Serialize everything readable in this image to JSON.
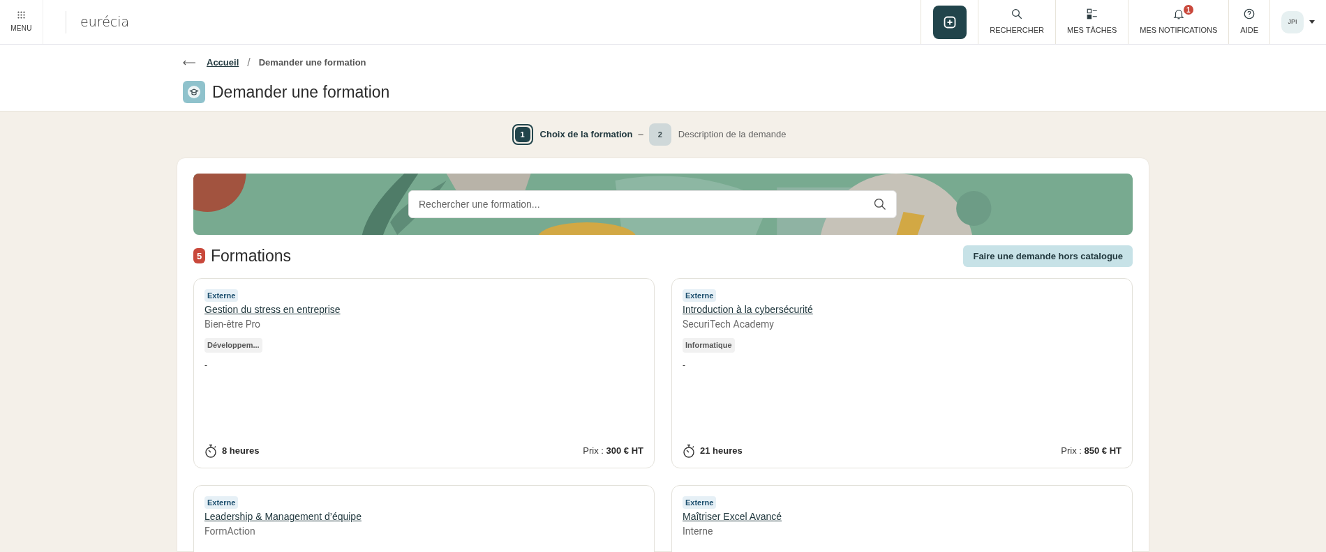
{
  "topbar": {
    "menu_label": "MENU",
    "logo": "eurécia",
    "nav": [
      {
        "kind": "search",
        "label": "RECHERCHER"
      },
      {
        "kind": "tasks",
        "label": "MES TÂCHES"
      },
      {
        "kind": "notifications",
        "label": "MES NOTIFICATIONS",
        "badge": "1"
      },
      {
        "kind": "help",
        "label": "AIDE"
      }
    ],
    "avatar": "JPI"
  },
  "breadcrumb_separator": "/",
  "breadcrumb": [
    {
      "label": "Accueil",
      "link": true
    },
    {
      "label": "Demander une formation",
      "link": false
    }
  ],
  "page_title": "Demander une formation",
  "steps": [
    {
      "number": "1",
      "label": "Choix de la formation",
      "selected": true
    },
    {
      "number": "2",
      "label": "Description de la demande",
      "selected": false
    }
  ],
  "step_separator": "–",
  "search": {
    "placeholder": "Rechercher une formation..."
  },
  "results": {
    "count": "5",
    "title": "Formations",
    "action": "Faire une demande hors catalogue"
  },
  "cards": [
    {
      "type_tag": "Externe",
      "title": "Gestion du stress en entreprise",
      "provider": "Bien-être Pro",
      "category": "Développem...",
      "description": "-",
      "duration": "8 heures",
      "price_label": "Prix :",
      "price": "300 € HT"
    },
    {
      "type_tag": "Externe",
      "title": "Introduction à la cybersécurité",
      "provider": "SecuriTech Academy",
      "category": "Informatique",
      "description": "-",
      "duration": "21 heures",
      "price_label": "Prix :",
      "price": "850 € HT"
    },
    {
      "type_tag": "Externe",
      "title": "Leadership & Management d’équipe",
      "provider": "FormAction"
    },
    {
      "type_tag": "Externe",
      "title": "Maîtriser Excel Avancé",
      "provider": "Interne"
    }
  ]
}
